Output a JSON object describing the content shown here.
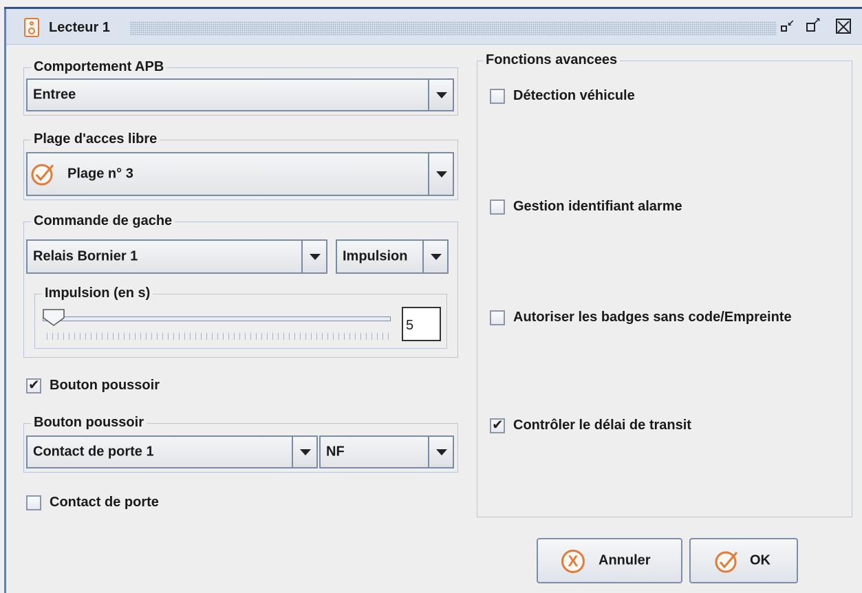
{
  "window": {
    "title": "Lecteur 1"
  },
  "left": {
    "comportement": {
      "legend": "Comportement APB",
      "value": "Entree"
    },
    "plage": {
      "legend": "Plage d'acces libre",
      "value": "Plage n° 3"
    },
    "gache": {
      "legend": "Commande de gache",
      "relais_value": "Relais Bornier 1",
      "mode_value": "Impulsion",
      "impulsion": {
        "legend": "Impulsion (en s)",
        "value": "5",
        "slider_level": 0.0
      }
    },
    "bouton_checkbox": {
      "label": "Bouton poussoir",
      "checked": true,
      "mark": "✔"
    },
    "bouton_group": {
      "legend": "Bouton poussoir",
      "contact_value": "Contact de porte 1",
      "type_value": "NF"
    },
    "contact_checkbox": {
      "label": "Contact de porte",
      "checked": false
    }
  },
  "right": {
    "legend": "Fonctions avancees",
    "options": [
      {
        "label": "Détection véhicule",
        "checked": false
      },
      {
        "label": "Gestion identifiant alarme",
        "checked": false
      },
      {
        "label": "Autoriser les badges sans code/Empreinte",
        "checked": false
      },
      {
        "label": "Contrôler le délai de transit",
        "checked": true,
        "mark": "✔"
      }
    ]
  },
  "buttons": {
    "cancel": "Annuler",
    "ok": "OK",
    "cancel_glyph": "X"
  },
  "colors": {
    "accent": "#e07b39",
    "titlebar": "#dbe3ee",
    "border": "#7a8ba6"
  },
  "icons": [
    "reader-icon",
    "minimize-icon",
    "maximize-icon",
    "close-icon",
    "chevron-down-icon",
    "check-circle-icon",
    "cancel-circle-icon"
  ]
}
